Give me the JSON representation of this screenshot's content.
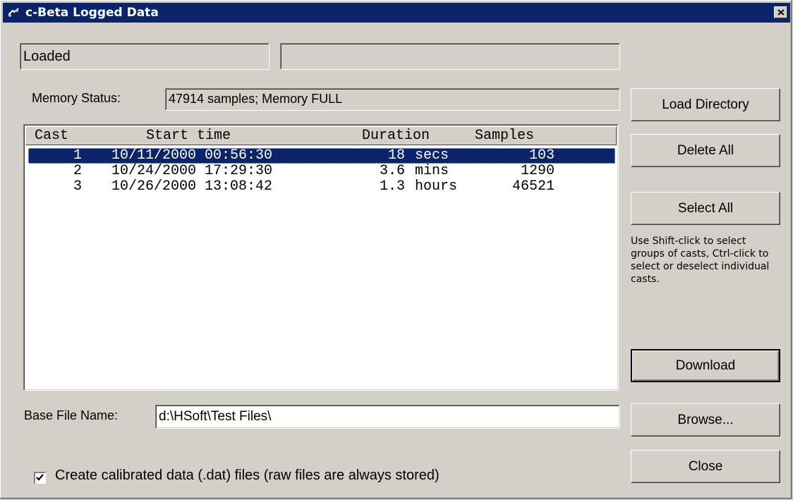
{
  "window": {
    "title": "c-Beta Logged Data",
    "close_label": "×"
  },
  "status": {
    "primary": "Loaded",
    "secondary": ""
  },
  "memory": {
    "label": "Memory Status:",
    "value": "47914 samples; Memory FULL"
  },
  "casts": {
    "columns": [
      "Cast",
      "Start time",
      "Duration",
      "Samples"
    ],
    "rows": [
      {
        "cast": "1",
        "start": "10/11/2000 00:56:30",
        "duration": "18",
        "unit": "secs",
        "samples": "103",
        "selected": true
      },
      {
        "cast": "2",
        "start": "10/24/2000 17:29:30",
        "duration": "3.6",
        "unit": "mins",
        "samples": "1290",
        "selected": false
      },
      {
        "cast": "3",
        "start": "10/26/2000 13:08:42",
        "duration": "1.3",
        "unit": "hours",
        "samples": "46521",
        "selected": false
      }
    ]
  },
  "buttons": {
    "load_directory": "Load Directory",
    "delete_all": "Delete All",
    "select_all": "Select All",
    "download": "Download",
    "browse": "Browse...",
    "close": "Close"
  },
  "help_text": "Use Shift-click to select groups of casts, Ctrl-click to select or deselect individual casts.",
  "base_file": {
    "label": "Base File Name:",
    "value": "d:\\HSoft\\Test Files\\"
  },
  "calibrated": {
    "label": "Create calibrated data (.dat) files (raw files are always stored)",
    "checked": true
  },
  "colors": {
    "face": "#d4d0c8",
    "titlebar": "#0a246a",
    "selection": "#0a246a"
  }
}
